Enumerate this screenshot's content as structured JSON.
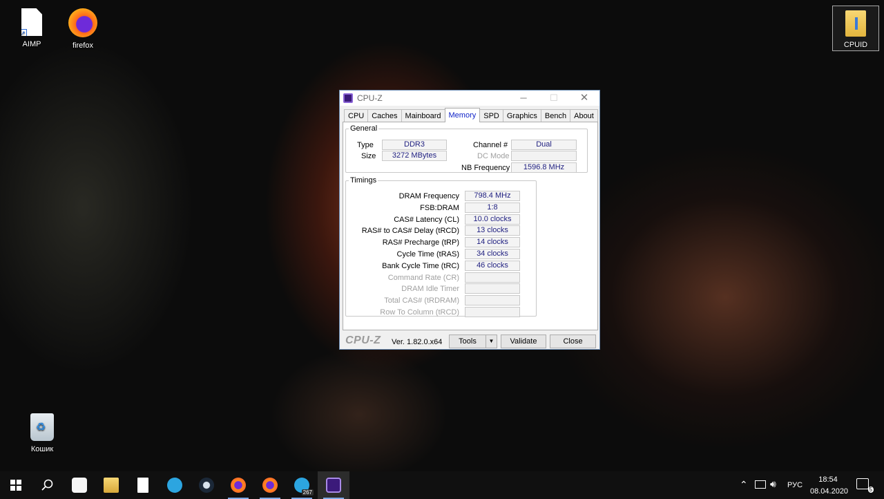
{
  "desktop": {
    "icons": [
      {
        "label": "AIMP",
        "icon": "document-shortcut-icon"
      },
      {
        "label": "firefox",
        "icon": "firefox-icon"
      },
      {
        "label": "CPUID",
        "icon": "folder-icon"
      },
      {
        "label": "Кошик",
        "icon": "recycle-bin-icon"
      }
    ]
  },
  "window": {
    "title": "CPU-Z",
    "tabs": [
      "CPU",
      "Caches",
      "Mainboard",
      "Memory",
      "SPD",
      "Graphics",
      "Bench",
      "About"
    ],
    "active_tab": "Memory",
    "general": {
      "legend": "General",
      "type_label": "Type",
      "type_value": "DDR3",
      "size_label": "Size",
      "size_value": "3272 MBytes",
      "channel_label": "Channel #",
      "channel_value": "Dual",
      "dcmode_label": "DC Mode",
      "dcmode_value": "",
      "nbfreq_label": "NB Frequency",
      "nbfreq_value": "1596.8 MHz"
    },
    "timings": {
      "legend": "Timings",
      "rows": [
        {
          "label": "DRAM Frequency",
          "value": "798.4 MHz",
          "enabled": true
        },
        {
          "label": "FSB:DRAM",
          "value": "1:8",
          "enabled": true
        },
        {
          "label": "CAS# Latency (CL)",
          "value": "10.0 clocks",
          "enabled": true
        },
        {
          "label": "RAS# to CAS# Delay (tRCD)",
          "value": "13 clocks",
          "enabled": true
        },
        {
          "label": "RAS# Precharge (tRP)",
          "value": "14 clocks",
          "enabled": true
        },
        {
          "label": "Cycle Time (tRAS)",
          "value": "34 clocks",
          "enabled": true
        },
        {
          "label": "Bank Cycle Time (tRC)",
          "value": "46 clocks",
          "enabled": true
        },
        {
          "label": "Command Rate (CR)",
          "value": "",
          "enabled": false
        },
        {
          "label": "DRAM Idle Timer",
          "value": "",
          "enabled": false
        },
        {
          "label": "Total CAS# (tRDRAM)",
          "value": "",
          "enabled": false
        },
        {
          "label": "Row To Column (tRCD)",
          "value": "",
          "enabled": false
        }
      ]
    },
    "footer": {
      "brand": "CPU-Z",
      "version": "Ver. 1.82.0.x64",
      "tools_label": "Tools",
      "validate_label": "Validate",
      "close_label": "Close"
    }
  },
  "taskbar": {
    "telegram_badge": "267",
    "tray": {
      "language": "РУС",
      "time": "18:54",
      "date": "08.04.2020",
      "notification_count": "5"
    }
  }
}
